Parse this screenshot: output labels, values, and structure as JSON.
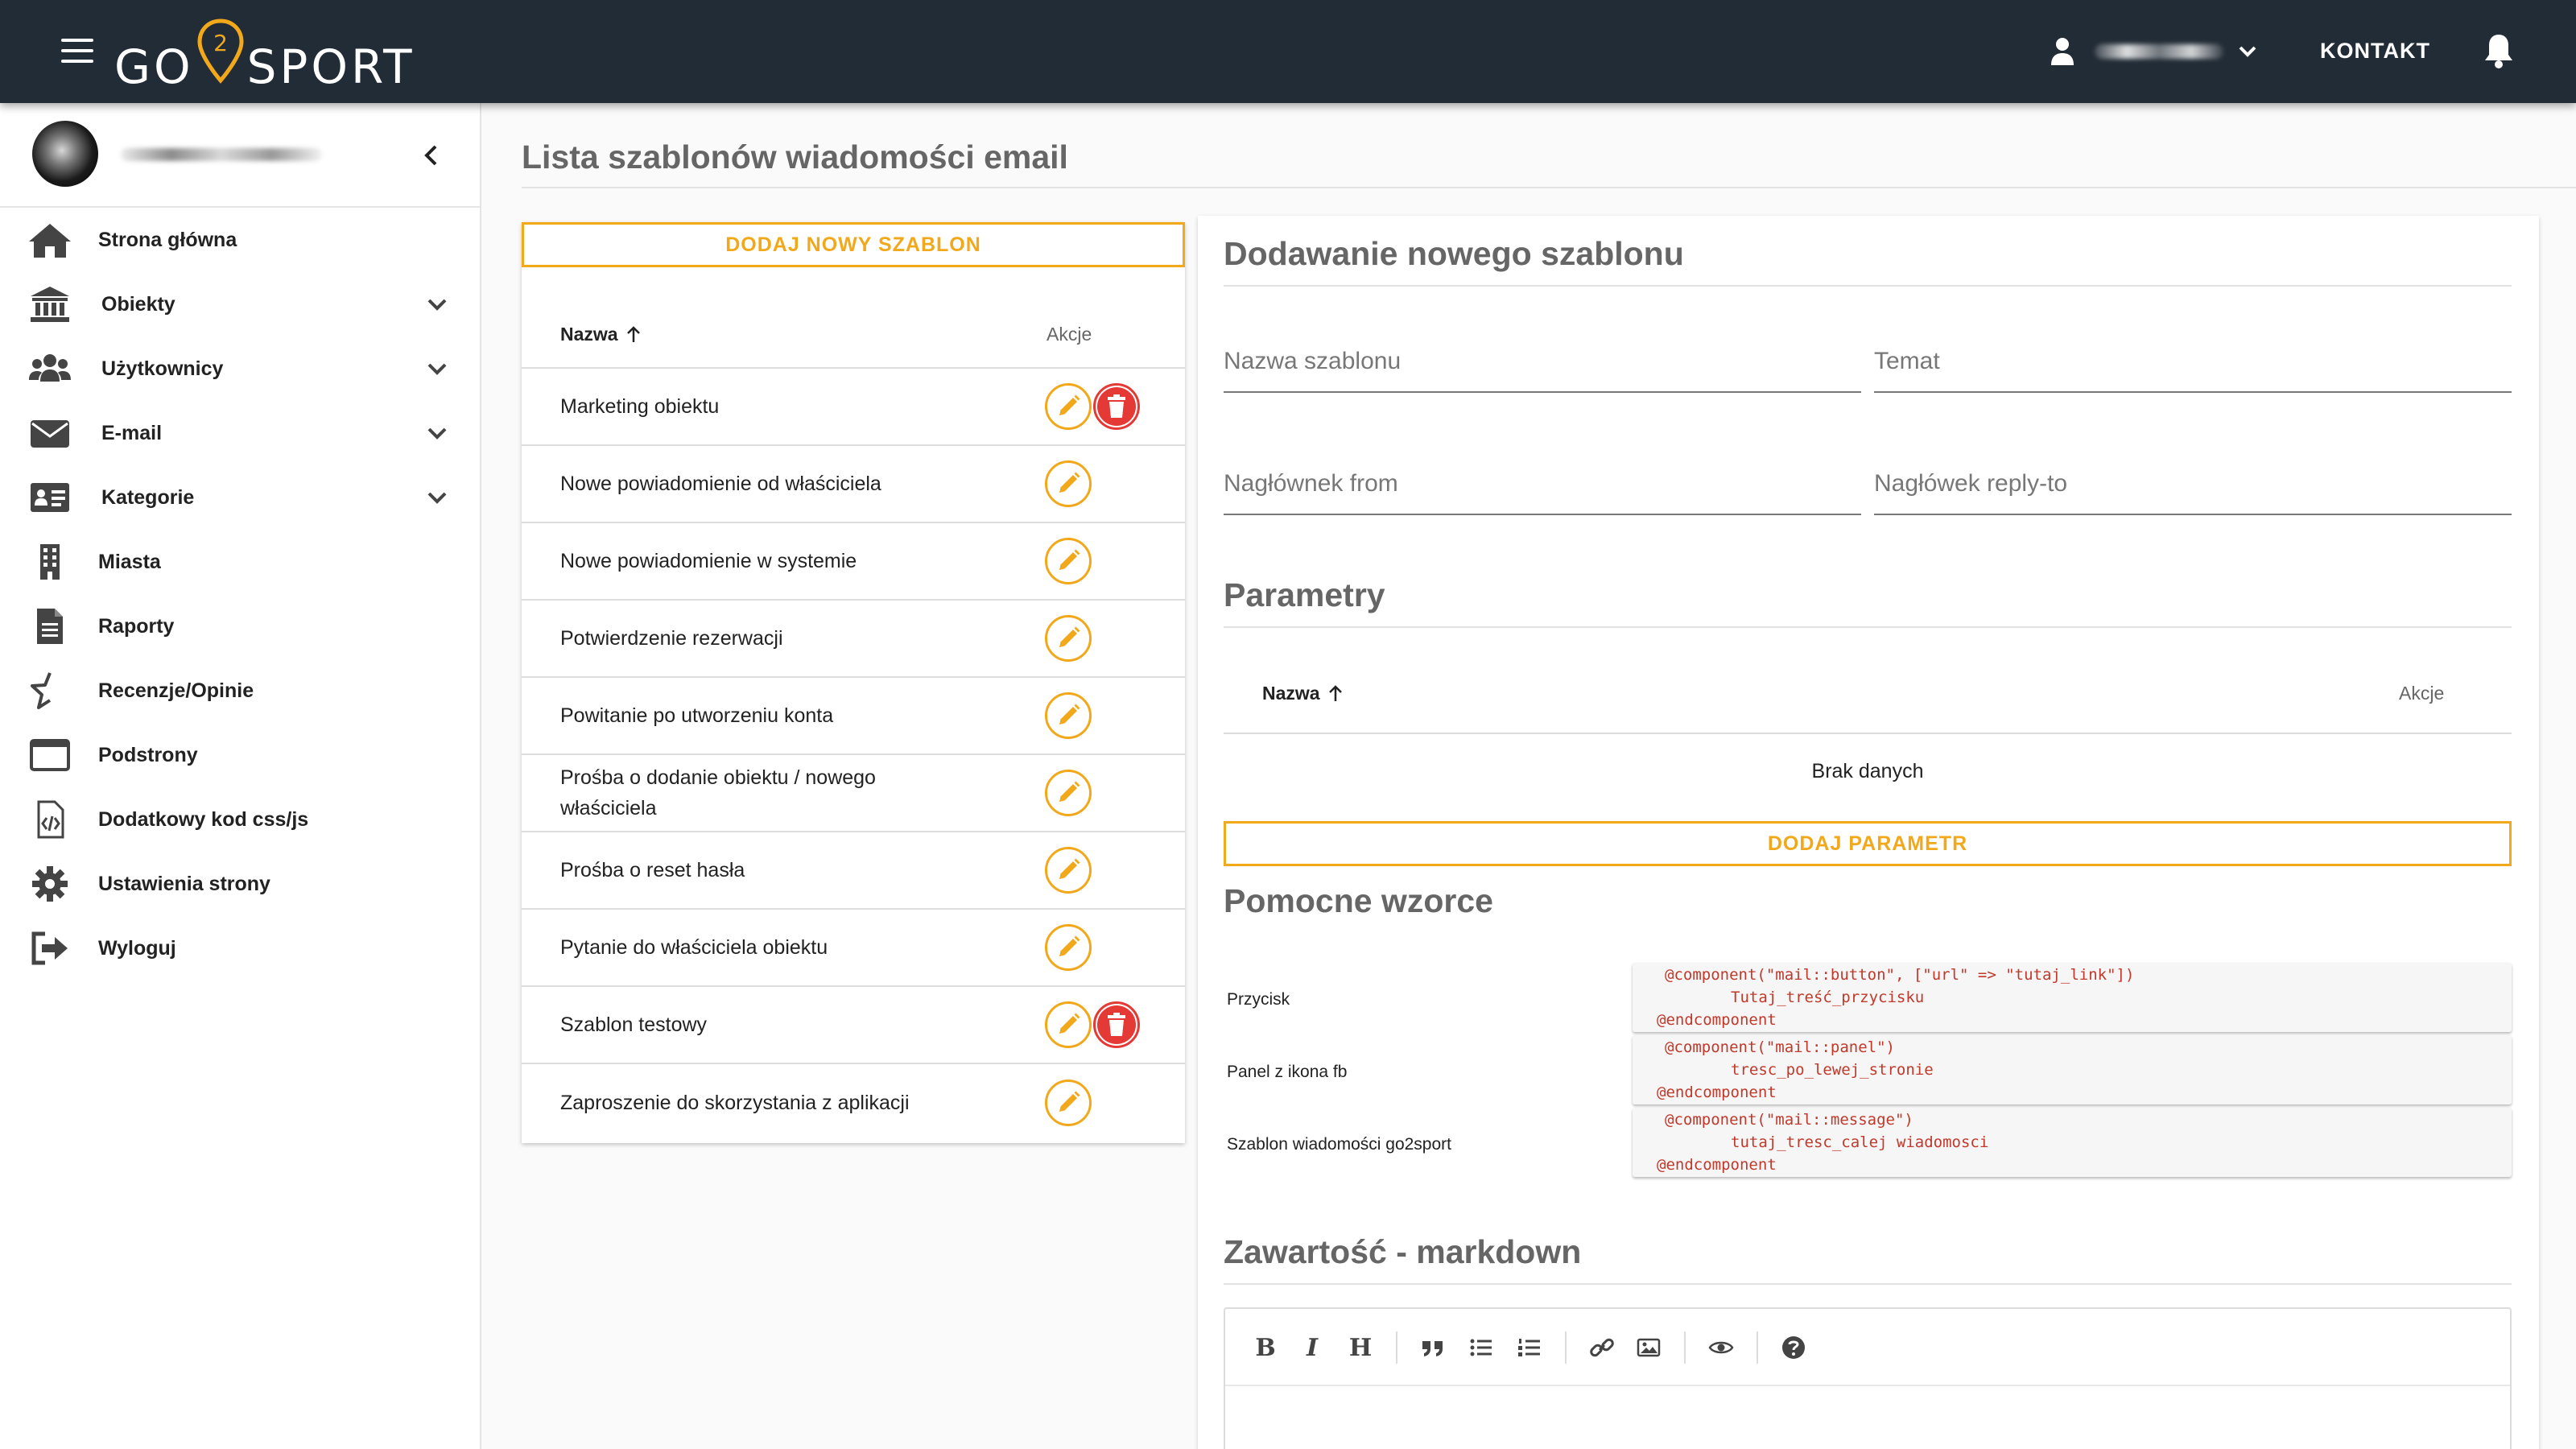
{
  "brand": {
    "logo_left": "GO",
    "logo_num": "2",
    "logo_right": "SPORT",
    "accent_color": "#f2a81b",
    "danger_color": "#e53935",
    "topbar_color": "#222c36"
  },
  "header": {
    "contact_label": "KONTAKT"
  },
  "sidebar": {
    "items": [
      {
        "label": "Strona główna",
        "icon": "home-icon",
        "has_submenu": false
      },
      {
        "label": "Obiekty",
        "icon": "bank-icon",
        "has_submenu": true
      },
      {
        "label": "Użytkownicy",
        "icon": "users-icon",
        "has_submenu": true
      },
      {
        "label": "E-mail",
        "icon": "envelope-icon",
        "has_submenu": true
      },
      {
        "label": "Kategorie",
        "icon": "id-card-icon",
        "has_submenu": true
      },
      {
        "label": "Miasta",
        "icon": "building-icon",
        "has_submenu": false
      },
      {
        "label": "Raporty",
        "icon": "document-icon",
        "has_submenu": false
      },
      {
        "label": "Recenzje/Opinie",
        "icon": "star-half-icon",
        "has_submenu": false
      },
      {
        "label": "Podstrony",
        "icon": "window-icon",
        "has_submenu": false
      },
      {
        "label": "Dodatkowy kod css/js",
        "icon": "code-file-icon",
        "has_submenu": false
      },
      {
        "label": "Ustawienia strony",
        "icon": "gear-icon",
        "has_submenu": false
      },
      {
        "label": "Wyloguj",
        "icon": "sign-out-icon",
        "has_submenu": false
      }
    ]
  },
  "page": {
    "title": "Lista szablonów wiadomości email"
  },
  "template_list": {
    "add_button": "DODAJ NOWY SZABLON",
    "col_name": "Nazwa",
    "col_actions": "Akcje",
    "rows": [
      {
        "name": "Marketing obiektu",
        "deletable": true
      },
      {
        "name": "Nowe powiadomienie od właściciela",
        "deletable": false
      },
      {
        "name": "Nowe powiadomienie w systemie",
        "deletable": false
      },
      {
        "name": "Potwierdzenie rezerwacji",
        "deletable": false
      },
      {
        "name": "Powitanie po utworzeniu konta",
        "deletable": false
      },
      {
        "name": "Prośba o dodanie obiektu / nowego właściciela",
        "deletable": false
      },
      {
        "name": "Prośba o reset hasła",
        "deletable": false
      },
      {
        "name": "Pytanie do właściciela obiektu",
        "deletable": false
      },
      {
        "name": "Szablon testowy",
        "deletable": true
      },
      {
        "name": "Zaproszenie do skorzystania z aplikacji",
        "deletable": false
      }
    ]
  },
  "form": {
    "title": "Dodawanie nowego szablonu",
    "fields": {
      "template_name": "Nazwa szablonu",
      "subject": "Temat",
      "header_from": "Nagłównek from",
      "header_reply_to": "Nagłówek reply-to"
    },
    "params": {
      "title": "Parametry",
      "col_name": "Nazwa",
      "col_actions": "Akcje",
      "empty": "Brak danych",
      "add_button": "DODAJ PARAMETR"
    },
    "patterns": {
      "title": "Pomocne wzorce",
      "items": [
        {
          "label": "Przycisk",
          "lines": [
            "@component(\"mail::button\", [\"url\" => \"tutaj_link\"])",
            "Tutaj_treść_przycisku",
            "@endcomponent"
          ]
        },
        {
          "label": "Panel z ikona fb",
          "lines": [
            "@component(\"mail::panel\")",
            "tresc_po_lewej_stronie",
            "@endcomponent"
          ]
        },
        {
          "label": "Szablon wiadomości go2sport",
          "lines": [
            "@component(\"mail::message\")",
            "tutaj_tresc_calej wiadomosci",
            "@endcomponent"
          ]
        }
      ]
    },
    "content": {
      "title": "Zawartość - markdown",
      "toolbar": {
        "bold": "B",
        "italic": "I",
        "heading": "H"
      }
    }
  }
}
